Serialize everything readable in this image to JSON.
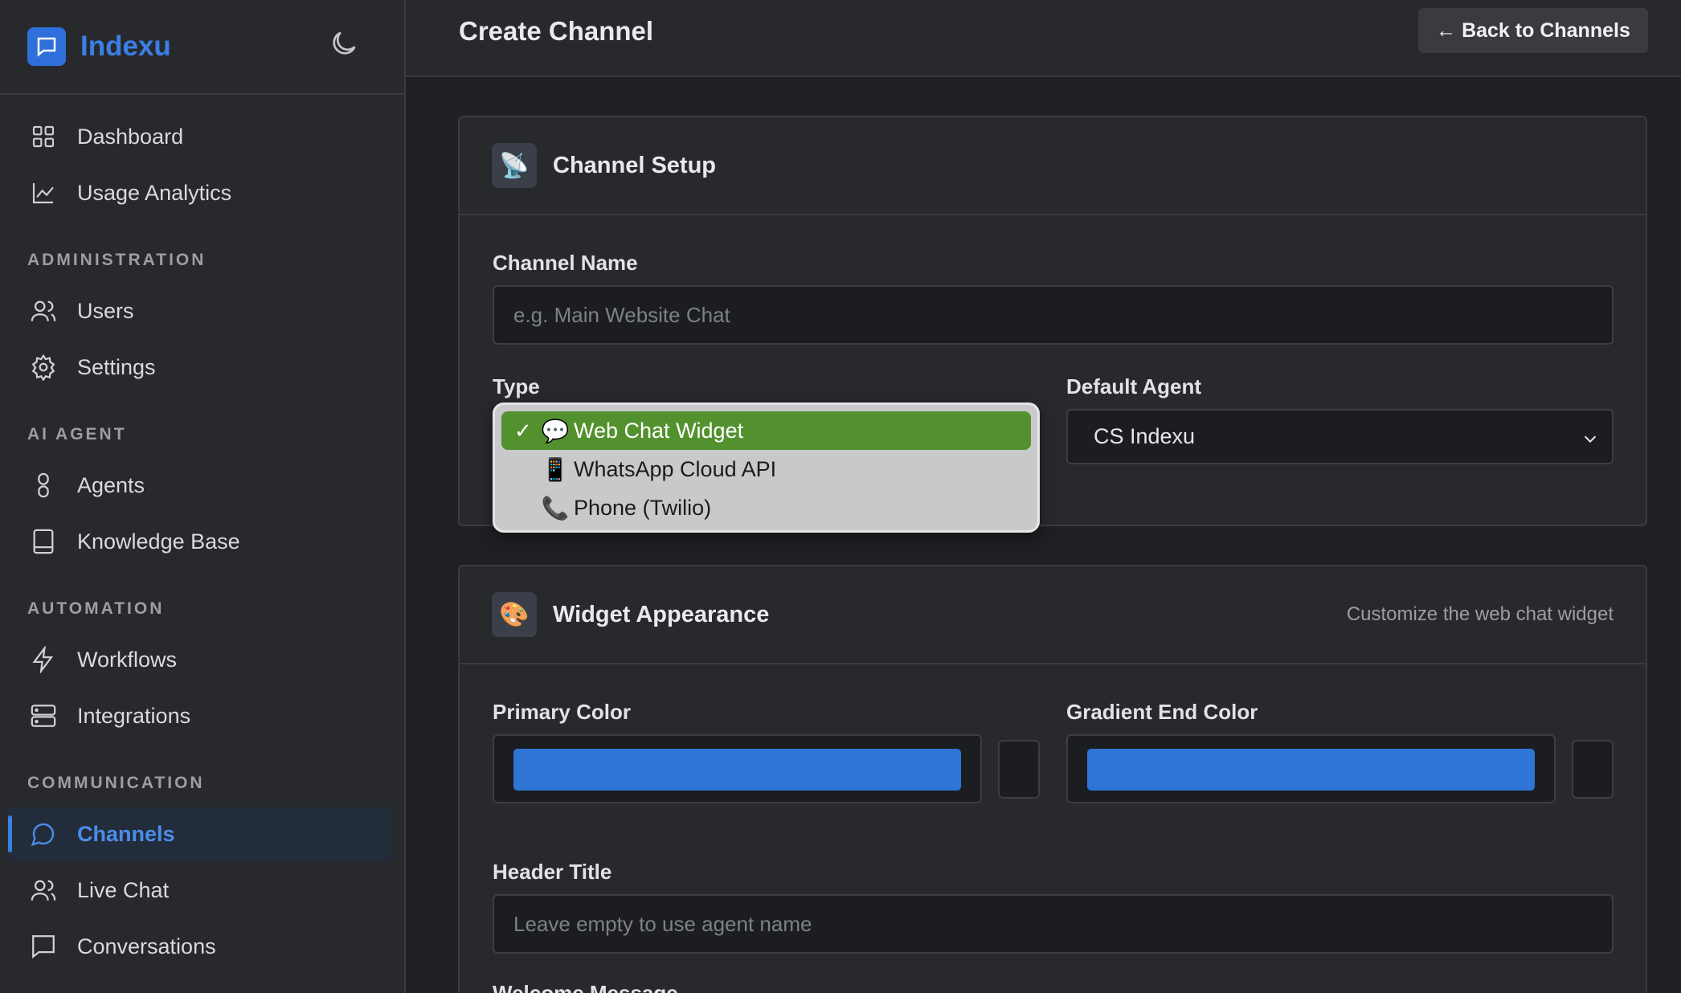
{
  "brand": {
    "name": "Indexu"
  },
  "sidebar": {
    "items_top": [
      {
        "label": "Dashboard"
      },
      {
        "label": "Usage Analytics"
      }
    ],
    "sections": {
      "administration": "ADMINISTRATION",
      "ai_agent": "AI AGENT",
      "automation": "AUTOMATION",
      "communication": "COMMUNICATION"
    },
    "admin_items": [
      {
        "label": "Users"
      },
      {
        "label": "Settings"
      }
    ],
    "ai_items": [
      {
        "label": "Agents"
      },
      {
        "label": "Knowledge Base"
      }
    ],
    "automation_items": [
      {
        "label": "Workflows"
      },
      {
        "label": "Integrations"
      }
    ],
    "communication_items": [
      {
        "label": "Channels",
        "active": true
      },
      {
        "label": "Live Chat"
      },
      {
        "label": "Conversations"
      }
    ]
  },
  "header": {
    "title": "Create Channel",
    "back_button": "← Back to Channels"
  },
  "channel_setup": {
    "title": "Channel Setup",
    "icon": "📡",
    "name_label": "Channel Name",
    "name_placeholder": "e.g. Main Website Chat",
    "type_label": "Type",
    "type_options": [
      {
        "emoji": "💬",
        "label": "Web Chat Widget",
        "selected": true
      },
      {
        "emoji": "📱",
        "label": "WhatsApp Cloud API"
      },
      {
        "emoji": "📞",
        "label": "Phone (Twilio)"
      }
    ],
    "agent_label": "Default Agent",
    "agent_value": "CS Indexu"
  },
  "widget_appearance": {
    "title": "Widget Appearance",
    "icon": "🎨",
    "subtitle": "Customize the web chat widget",
    "primary_label": "Primary Color",
    "primary_color": "#2f75d6",
    "gradient_label": "Gradient End Color",
    "gradient_color": "#2f75d6",
    "header_title_label": "Header Title",
    "header_title_placeholder": "Leave empty to use agent name",
    "welcome_label": "Welcome Message"
  },
  "colors": {
    "accent": "#3b7fe6",
    "selected_option": "#53912e"
  }
}
